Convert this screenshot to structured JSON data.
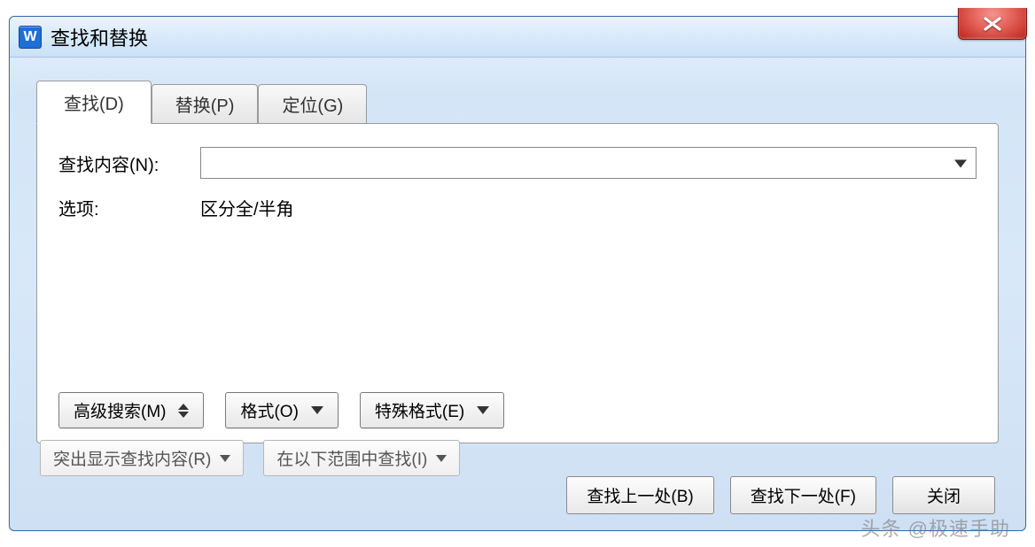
{
  "window": {
    "title": "查找和替换"
  },
  "tabs": {
    "find": "查找(D)",
    "replace": "替换(P)",
    "goto": "定位(G)"
  },
  "labels": {
    "find_content": "查找内容(N):",
    "options": "选项:"
  },
  "values": {
    "find_content": "",
    "options": "区分全/半角"
  },
  "buttons": {
    "advanced": "高级搜索(M)",
    "format": "格式(O)",
    "special": "特殊格式(E)",
    "highlight": "突出显示查找内容(R)",
    "find_in": "在以下范围中查找(I)",
    "find_prev": "查找上一处(B)",
    "find_next": "查找下一处(F)",
    "close": "关闭"
  },
  "watermark": "头条 @极速手助"
}
